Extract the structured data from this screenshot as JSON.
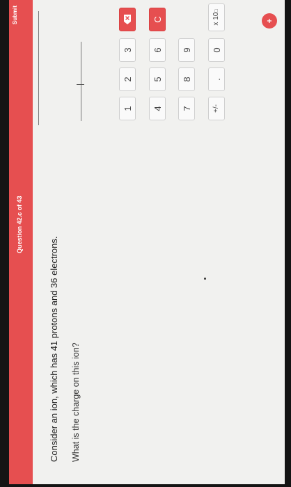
{
  "header": {
    "question_counter": "Question 42.c of 43",
    "submit_label": "Submit"
  },
  "question": {
    "text": "Consider an ion, which has 41 protons and 36 electrons.",
    "prompt": "What is the charge on this ion?"
  },
  "keypad": {
    "rows": [
      [
        "1",
        "2",
        "3"
      ],
      [
        "4",
        "5",
        "6"
      ],
      [
        "7",
        "8",
        "9"
      ],
      [
        "+/-",
        ".",
        "0"
      ]
    ],
    "delete_icon": "delete-icon",
    "clear_label": "C",
    "exponent_label": "x 10",
    "add_label": "+"
  },
  "colors": {
    "accent": "#e64f50",
    "background": "#f1f1ef",
    "key_background": "#fafafa"
  }
}
